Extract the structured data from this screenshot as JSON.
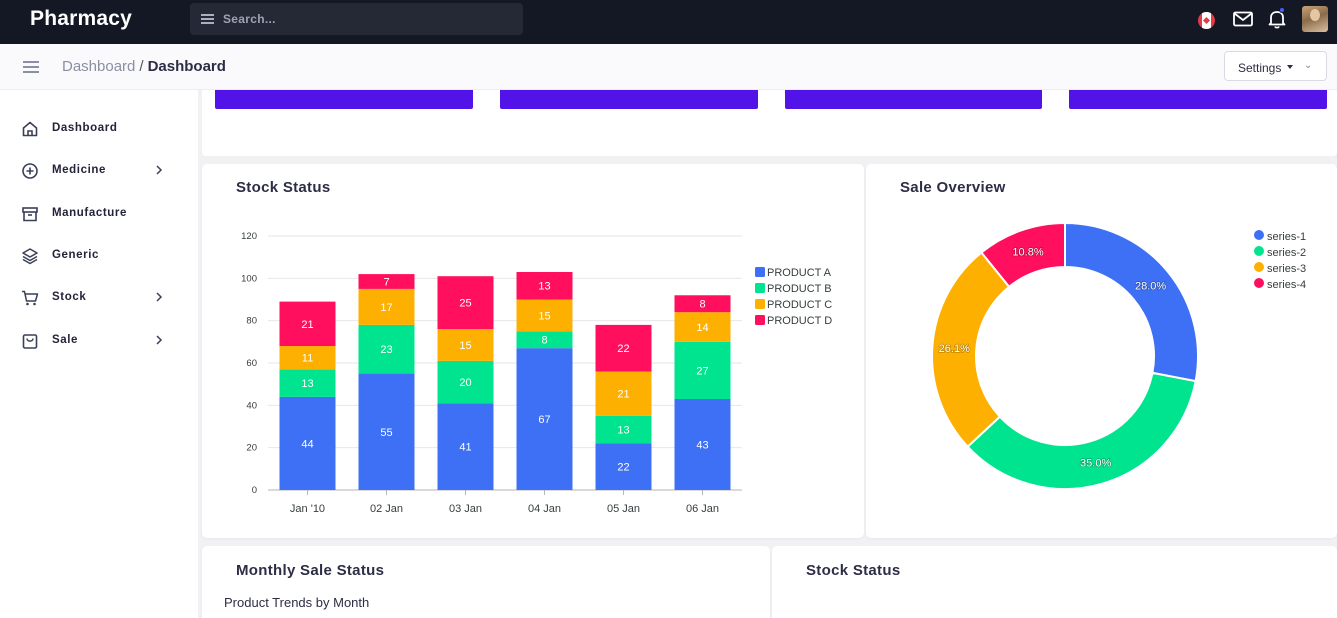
{
  "app": {
    "brand": "Pharmacy",
    "search_placeholder": "Search..."
  },
  "breadcrumb": {
    "parent": "Dashboard",
    "separator": "/",
    "current": "Dashboard"
  },
  "settings_label": "Settings",
  "sidebar": {
    "items": [
      {
        "label": "Dashboard",
        "icon": "home-icon",
        "has_submenu": false
      },
      {
        "label": "Medicine",
        "icon": "plus-circle-icon",
        "has_submenu": true
      },
      {
        "label": "Manufacture",
        "icon": "archive-icon",
        "has_submenu": false
      },
      {
        "label": "Generic",
        "icon": "layers-icon",
        "has_submenu": false
      },
      {
        "label": "Stock",
        "icon": "cart-icon",
        "has_submenu": true
      },
      {
        "label": "Sale",
        "icon": "bag-icon",
        "has_submenu": true
      }
    ]
  },
  "colors": {
    "accent": "#5213e8",
    "series": [
      "#3d70f5",
      "#00e48f",
      "#feb000",
      "#ff0f5e"
    ]
  },
  "cards": {
    "stock_status_title": "Stock Status",
    "sale_overview_title": "Sale Overview",
    "monthly_sale_title": "Monthly Sale Status",
    "monthly_sale_subtitle": "Product Trends by Month",
    "stock_status_2_title": "Stock Status"
  },
  "chart_data": [
    {
      "type": "bar",
      "stacked": true,
      "categories": [
        "Jan '10",
        "02 Jan",
        "03 Jan",
        "04 Jan",
        "05 Jan",
        "06 Jan"
      ],
      "series": [
        {
          "name": "PRODUCT A",
          "values": [
            44,
            55,
            41,
            67,
            22,
            43
          ]
        },
        {
          "name": "PRODUCT B",
          "values": [
            13,
            23,
            20,
            8,
            13,
            27
          ]
        },
        {
          "name": "PRODUCT C",
          "values": [
            11,
            17,
            15,
            15,
            21,
            14
          ]
        },
        {
          "name": "PRODUCT D",
          "values": [
            21,
            7,
            25,
            13,
            22,
            8
          ]
        }
      ],
      "yticks": [
        0,
        20,
        40,
        60,
        80,
        100,
        120
      ],
      "ylim": [
        0,
        120
      ],
      "grid": true,
      "legend": "right"
    },
    {
      "type": "pie",
      "donut": true,
      "labels": [
        "series-1",
        "series-2",
        "series-3",
        "series-4"
      ],
      "values": [
        28.0,
        35.0,
        26.1,
        10.8
      ],
      "value_labels": [
        "28.0%",
        "35.0%",
        "26.1%",
        "10.8%"
      ],
      "legend": "top-right"
    }
  ]
}
